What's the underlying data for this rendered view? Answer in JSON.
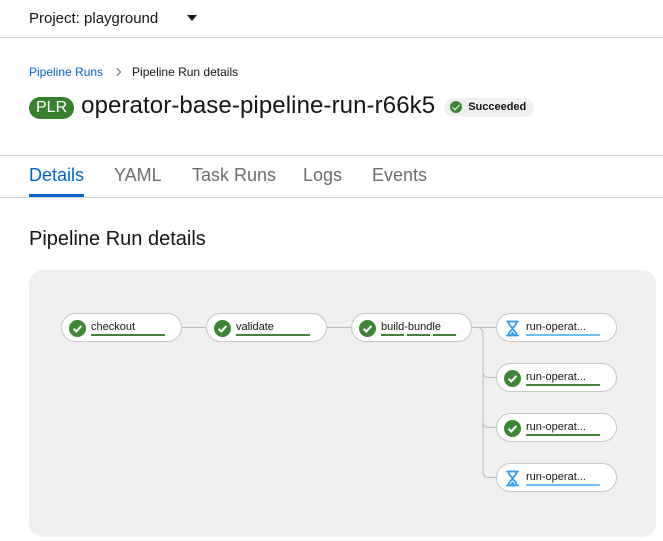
{
  "project_bar": {
    "label": "Project: playground"
  },
  "breadcrumb": {
    "parent": "Pipeline Runs",
    "current": "Pipeline Run details"
  },
  "title": {
    "badge": "PLR",
    "name": "operator-base-pipeline-run-r66k5",
    "status": "Succeeded"
  },
  "tabs": [
    {
      "label": "Details",
      "active": true
    },
    {
      "label": "YAML",
      "active": false
    },
    {
      "label": "Task Runs",
      "active": false
    },
    {
      "label": "Logs",
      "active": false
    },
    {
      "label": "Events",
      "active": false
    }
  ],
  "section_title": "Pipeline Run details",
  "pipeline": {
    "tasks": [
      {
        "label": "checkout",
        "status": "succeeded"
      },
      {
        "label": "validate",
        "status": "succeeded"
      },
      {
        "label": "build-bundle",
        "status": "succeeded"
      },
      {
        "label": "run-operat...",
        "status": "pending"
      },
      {
        "label": "run-operat...",
        "status": "succeeded"
      },
      {
        "label": "run-operat...",
        "status": "succeeded"
      },
      {
        "label": "run-operat...",
        "status": "pending"
      }
    ]
  },
  "colors": {
    "link": "#0066cc",
    "success": "#3e8635",
    "plr_badge": "#38812f",
    "pending": "#73bcf7",
    "panel_bg": "#f0f0f0"
  }
}
